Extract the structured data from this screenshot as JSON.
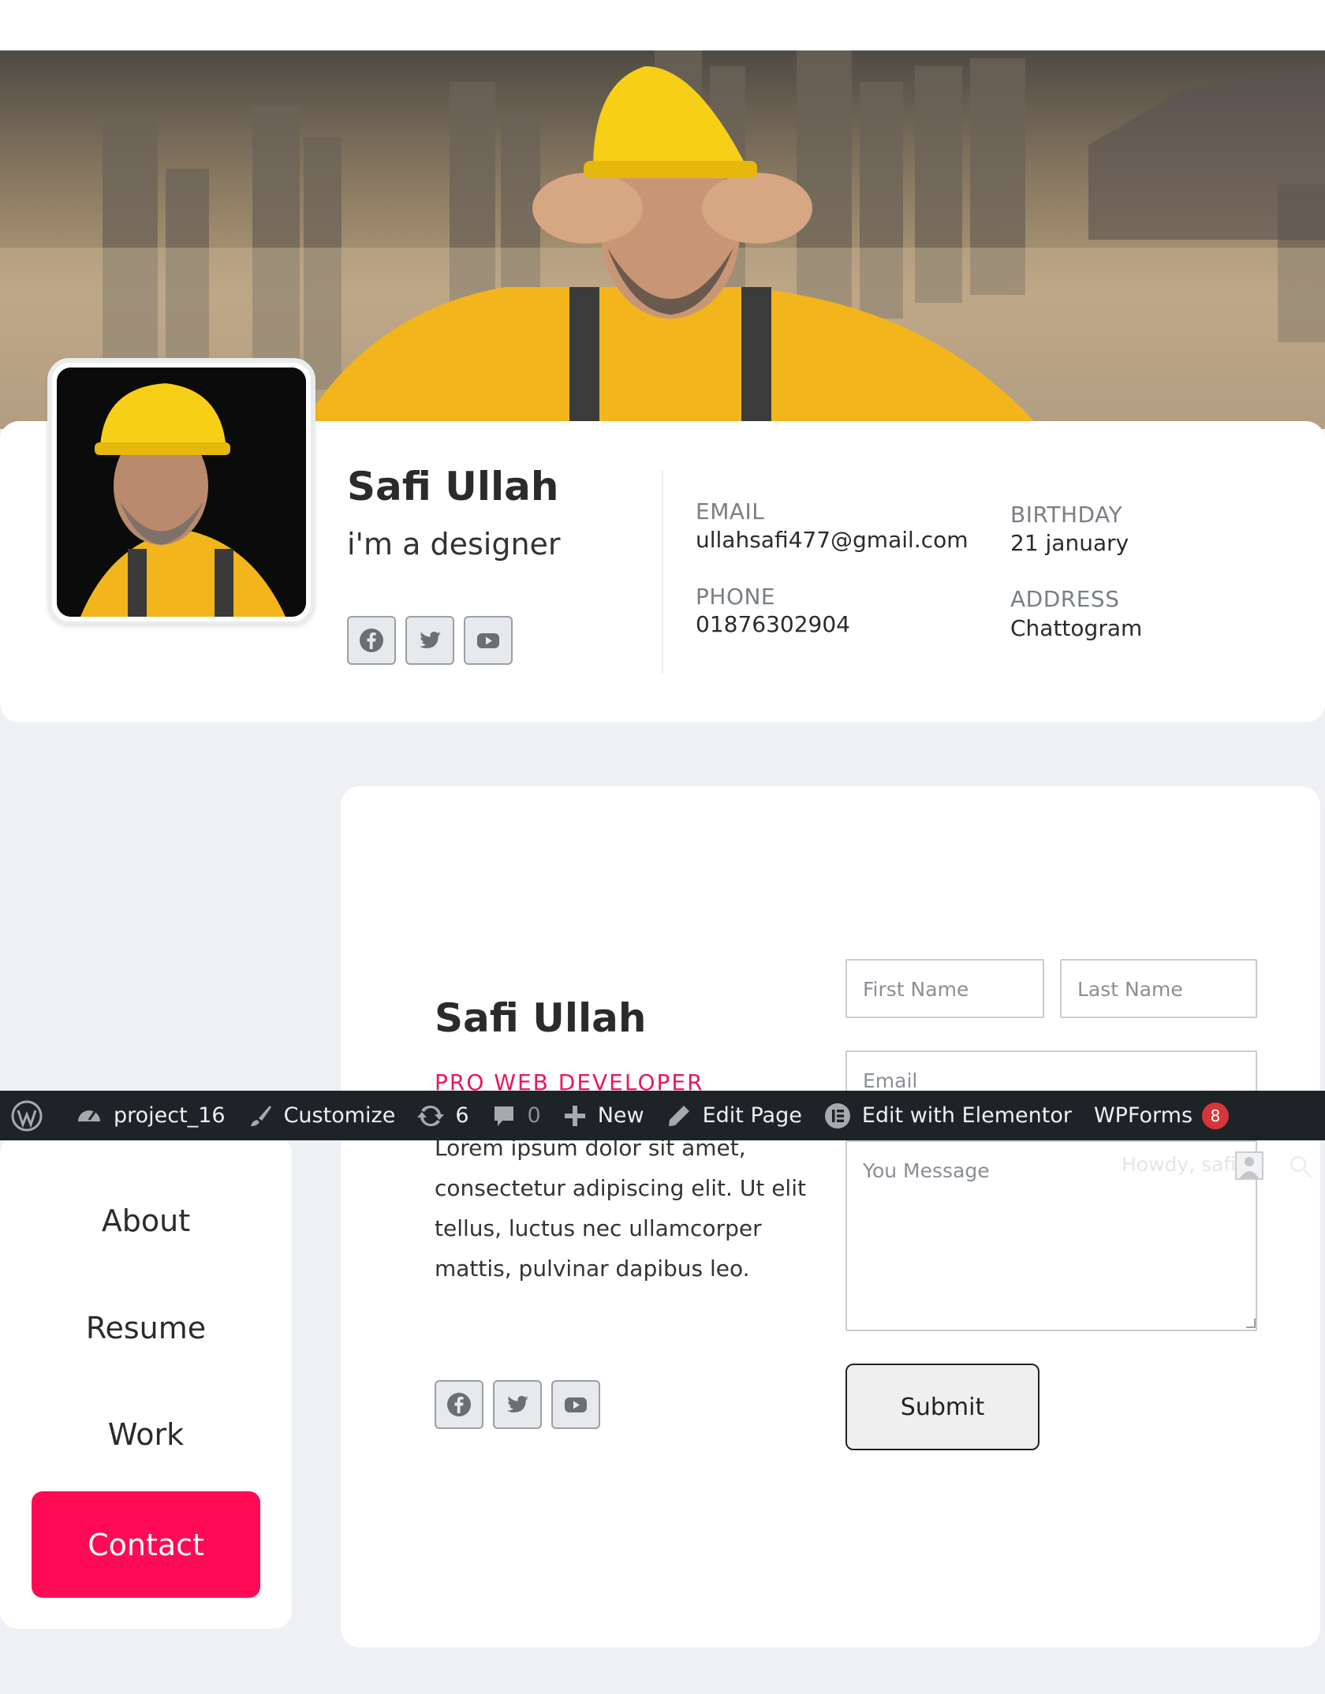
{
  "profile": {
    "name": "Safi Ullah",
    "role": "i'm a designer",
    "email_label": "EMAIL",
    "email": "ullahsafi477@gmail.com",
    "phone_label": "PHONE",
    "phone": "01876302904",
    "birthday_label": "BIRTHDAY",
    "birthday": "21 january",
    "address_label": "ADDRESS",
    "address": "Chattogram",
    "social_icons": [
      "facebook-icon",
      "twitter-icon",
      "youtube-icon"
    ]
  },
  "nav": {
    "items": [
      "About",
      "Resume",
      "Work",
      "Contact"
    ],
    "active": "Contact"
  },
  "contact": {
    "name": "Safi Ullah",
    "role": "PRO WEB DEVELOPER",
    "description": "Lorem ipsum dolor sit amet, consectetur adipiscing elit. Ut elit tellus, luctus nec ullamcorper mattis, pulvinar dapibus leo.",
    "first_name_placeholder": "First Name",
    "last_name_placeholder": "Last Name",
    "email_placeholder": "Email",
    "message_placeholder": "You Message",
    "submit_label": "Submit"
  },
  "adminbar": {
    "site_name": "project_16",
    "customize": "Customize",
    "updates_count": "6",
    "comments_count": "0",
    "new_label": "New",
    "edit_page": "Edit Page",
    "edit_elementor": "Edit with Elementor",
    "wpforms": "WPForms",
    "wpforms_badge": "8",
    "howdy": "Howdy, safi"
  },
  "colors": {
    "accent": "#ff0a54",
    "role_accent": "#e8175d",
    "adminbar_bg": "#1d2327",
    "page_bg": "#eef0f3"
  }
}
